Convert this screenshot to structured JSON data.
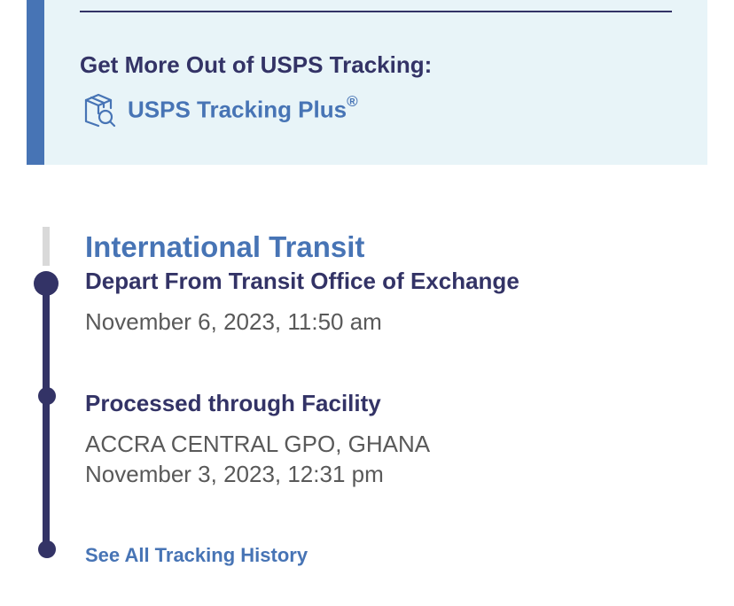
{
  "promo": {
    "heading": "Get More Out of USPS Tracking:",
    "link_label": "USPS Tracking Plus",
    "link_mark": "®",
    "icon": "package-search-icon",
    "colors": {
      "background": "#e8f4f8",
      "stripe": "#4774b5",
      "heading": "#333366",
      "link": "#4774b5"
    }
  },
  "tracking": {
    "status": "International Transit",
    "events": [
      {
        "title": "Depart From Transit Office of Exchange",
        "location": "",
        "datetime": "November 6, 2023, 11:50 am"
      },
      {
        "title": "Processed through Facility",
        "location": "ACCRA CENTRAL GPO, GHANA",
        "datetime": "November 3, 2023, 12:31 pm"
      }
    ],
    "see_all_label": "See All Tracking History",
    "colors": {
      "timeline": "#333366",
      "timeline_pending": "#d9d9d9",
      "status": "#4774b5",
      "detail_text": "#595959"
    }
  }
}
